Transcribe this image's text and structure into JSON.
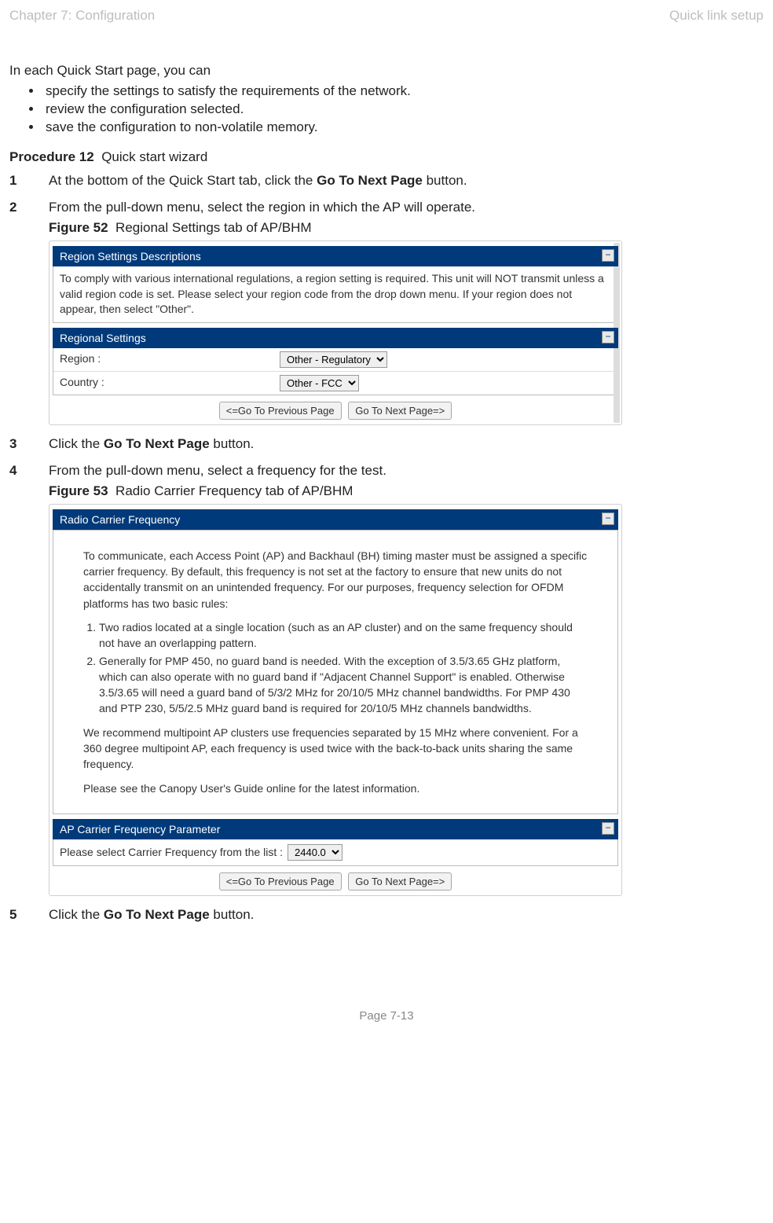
{
  "header": {
    "left": "Chapter 7:  Configuration",
    "right": "Quick link setup"
  },
  "intro": "In each Quick Start page, you can",
  "bullets": [
    "specify the settings to satisfy the requirements of the network.",
    "review the configuration selected.",
    "save the configuration to non-volatile memory."
  ],
  "procedure": {
    "label": "Procedure 12",
    "title": "Quick start wizard"
  },
  "steps": {
    "s1": {
      "pre": "At the bottom of the Quick Start tab, click the ",
      "bold": "Go To Next Page",
      "post": " button."
    },
    "s2": {
      "text": "From the pull-down menu, select the region in which the AP will operate."
    },
    "s3": {
      "pre": "Click the ",
      "bold": "Go To Next Page",
      "post": " button."
    },
    "s4": {
      "text": "From the pull-down menu, select a frequency for the test."
    },
    "s5": {
      "pre": "Click the ",
      "bold": "Go To Next Page",
      "post": " button."
    }
  },
  "fig52": {
    "label": "Figure 52",
    "title": "Regional Settings tab of AP/BHM",
    "panel1_title": "Region Settings Descriptions",
    "panel1_body": "To comply with various international regulations, a region setting is required. This unit will NOT transmit unless a valid region code is set. Please select your region code from the drop down menu. If your region does not appear, then select \"Other\".",
    "panel2_title": "Regional Settings",
    "region_label": "Region :",
    "region_value": "Other - Regulatory",
    "country_label": "Country :",
    "country_value": "Other - FCC",
    "btn_prev": "<=Go To Previous Page",
    "btn_next": "Go To Next Page=>"
  },
  "fig53": {
    "label": "Figure 53",
    "title": "Radio Carrier Frequency tab of AP/BHM",
    "panel1_title": "Radio Carrier Frequency",
    "p1": "To communicate, each Access Point (AP) and Backhaul (BH) timing master must be assigned a specific carrier frequency. By default, this frequency is not set at the factory to ensure that new units do not accidentally transmit on an unintended frequency. For our purposes, frequency selection for OFDM platforms has two basic rules:",
    "li1": "Two radios located at a single location (such as an AP cluster) and on the same frequency should not have an overlapping pattern.",
    "li2": "Generally for PMP 450, no guard band is needed. With the exception of 3.5/3.65 GHz platform, which can also operate with no guard band if \"Adjacent Channel Support\" is enabled. Otherwise 3.5/3.65 will need a guard band of 5/3/2 MHz for 20/10/5 MHz channel bandwidths. For PMP 430 and PTP 230, 5/5/2.5 MHz guard band is required for 20/10/5 MHz channels bandwidths.",
    "p2": "We recommend multipoint AP clusters use frequencies separated by 15 MHz where convenient. For a 360 degree multipoint AP, each frequency is used twice with the back-to-back units sharing the same frequency.",
    "p3": "Please see the Canopy User's Guide online for the latest information.",
    "panel2_title": "AP Carrier Frequency Parameter",
    "freq_label": "Please select Carrier Frequency from the list :",
    "freq_value": "2440.0",
    "btn_prev": "<=Go To Previous Page",
    "btn_next": "Go To Next Page=>"
  },
  "footer": "Page 7-13"
}
